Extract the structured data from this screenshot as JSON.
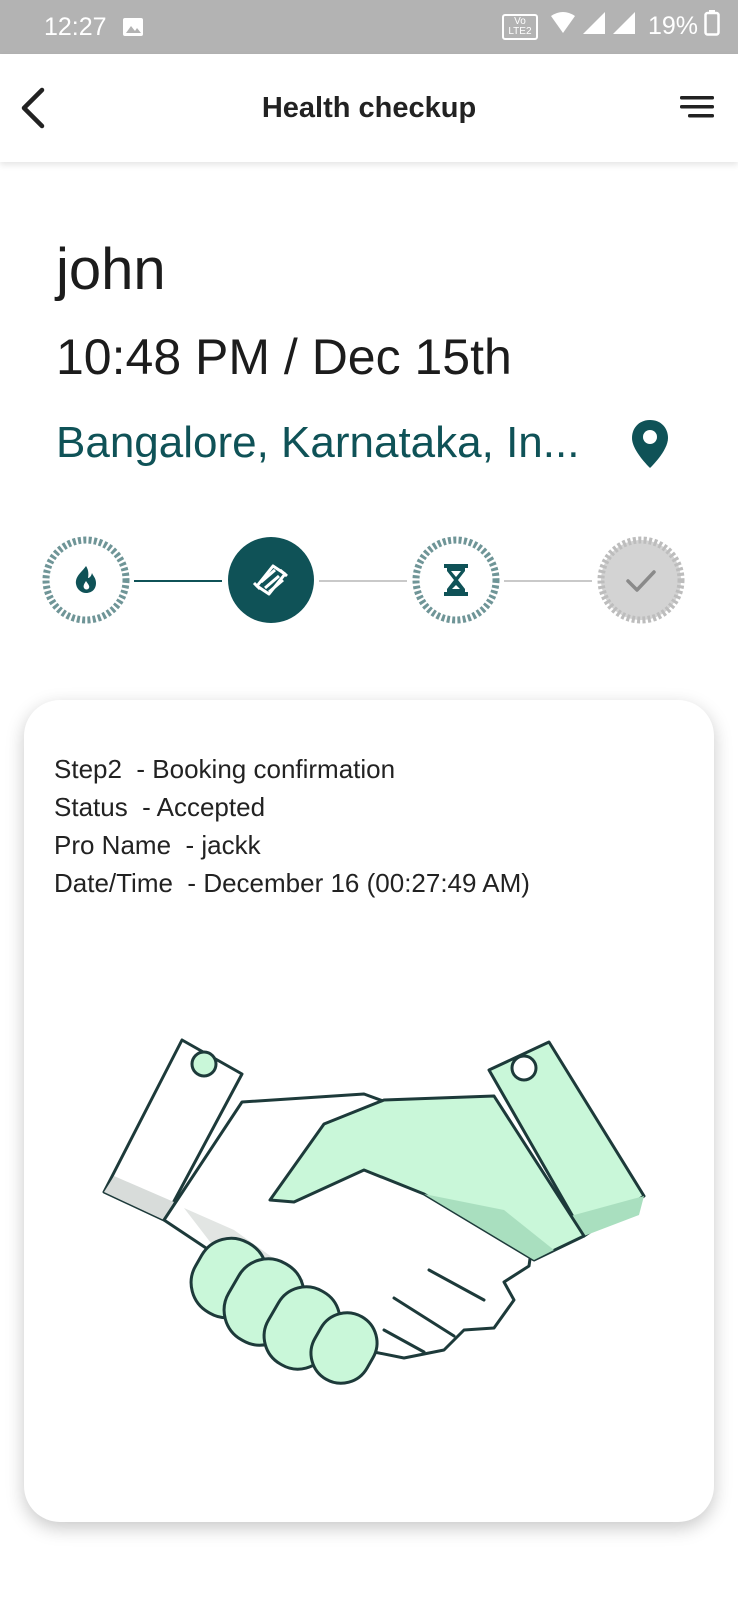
{
  "status_bar": {
    "time": "12:27",
    "battery_percent": "19%",
    "volte_line1": "Vo LTE",
    "volte_line2": "LTE 2"
  },
  "app_bar": {
    "title": "Health checkup"
  },
  "booking": {
    "name": "john",
    "datetime": "10:48 PM / Dec 15th",
    "location": "Bangalore, Karnataka, In..."
  },
  "stepper": {
    "current_step": 2,
    "total_steps": 4,
    "steps": [
      {
        "icon": "flame-icon",
        "state": "done"
      },
      {
        "icon": "handshake-icon",
        "state": "active"
      },
      {
        "icon": "hourglass-icon",
        "state": "pending"
      },
      {
        "icon": "check-icon",
        "state": "inactive"
      }
    ]
  },
  "details": {
    "step_label": "Step2",
    "step_value": "Booking confirmation",
    "status_label": "Status",
    "status_value": "Accepted",
    "pro_label": "Pro Name",
    "pro_value": "jackk",
    "datetime_label": "Date/Time",
    "datetime_value": "December 16  (00:27:49 AM)"
  },
  "colors": {
    "primary": "#0f5257",
    "accent_green": "#c9f7d9",
    "status_bar": "#b3b3b3",
    "inactive_grey": "#c8c8c8"
  }
}
